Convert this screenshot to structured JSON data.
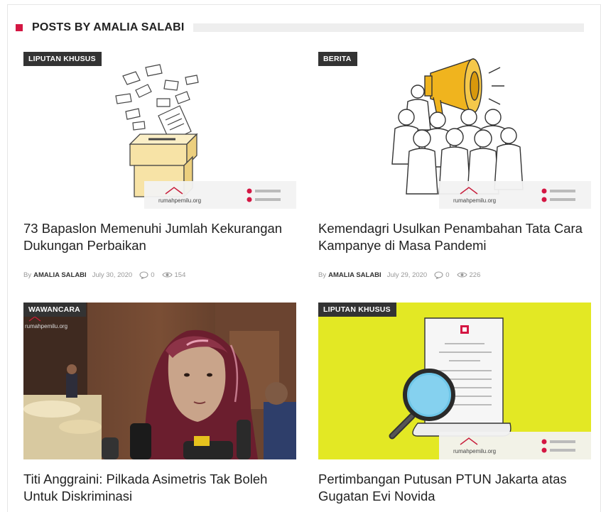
{
  "section": {
    "title": "POSTS BY AMALIA SALABI"
  },
  "posts": [
    {
      "category": "LIPUTAN KHUSUS",
      "title": "73 Bapaslon Memenuhi Jumlah Kekurangan Dukungan Perbaikan",
      "by": "By",
      "author": "AMALIA SALABI",
      "date": "July 30, 2020",
      "comments": "0",
      "views": "154",
      "watermark": "rumahpemilu.org"
    },
    {
      "category": "BERITA",
      "title": "Kemendagri Usulkan Penambahan Tata Cara Kampanye di Masa Pandemi",
      "by": "By",
      "author": "AMALIA SALABI",
      "date": "July 29, 2020",
      "comments": "0",
      "views": "226",
      "watermark": "rumahpemilu.org"
    },
    {
      "category": "WAWANCARA",
      "title": "Titi Anggraini: Pilkada Asimetris Tak Boleh Untuk Diskriminasi",
      "watermark": "rumahpemilu.org"
    },
    {
      "category": "LIPUTAN KHUSUS",
      "title": "Pertimbangan Putusan PTUN Jakarta atas Gugatan Evi Novida",
      "watermark": "rumahpemilu.org"
    }
  ],
  "colors": {
    "accent": "#d41743",
    "badge_bg": "#333333",
    "highlight_yellow": "#e3e824",
    "ballot_box": "#f7e3a6",
    "megaphone": "#f0b41e"
  }
}
